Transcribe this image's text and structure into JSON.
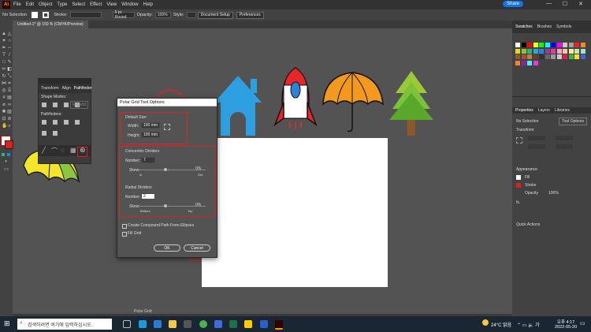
{
  "app": {
    "logo": "Ai"
  },
  "menu": {
    "items": [
      "File",
      "Edit",
      "Object",
      "Type",
      "Select",
      "Effect",
      "View",
      "Window",
      "Help"
    ],
    "share": "Share"
  },
  "control_bar": {
    "selection": "No Selection",
    "stroke_label": "Stroke:",
    "stroke_value": "5 pt. Round",
    "opacity_label": "Opacity:",
    "opacity_value": "100%",
    "style_label": "Style:",
    "doc_setup": "Document Setup",
    "preferences": "Preferences"
  },
  "document_tab": {
    "label": "Untitled-1* @ 150 % (CMYK/Preview)"
  },
  "pathfinder_panel": {
    "tabs": [
      "Transform",
      "Align",
      "Pathfinder"
    ],
    "shape_modes": "Shape Modes:",
    "expand": "Expand",
    "pathfinders": "Pathfinders:"
  },
  "dialog": {
    "title": "Polar Grid Tool Options",
    "default_size": "Default Size",
    "width_label": "Width:",
    "width_value": "100 mm",
    "height_label": "Height:",
    "height_value": "100 mm",
    "concentric": "Concentric Dividers",
    "conc_number_label": "Number:",
    "conc_number": "7",
    "conc_skew_label": "Skew:",
    "conc_skew": "0%",
    "conc_in": "In",
    "conc_out": "Out",
    "radial": "Radial Dividers",
    "rad_number_label": "Number:",
    "rad_number": "2",
    "rad_skew_label": "Skew:",
    "rad_skew": "0%",
    "rad_bottom": "Bottom",
    "rad_top": "Top",
    "compound": "Create Compound Path From Ellipses",
    "fill_grid": "Fill Grid",
    "ok": "OK",
    "cancel": "Cancel"
  },
  "right_panel": {
    "top_tabs": [
      "Swatches",
      "Brushes",
      "Symbols"
    ],
    "props_tabs": [
      "Properties",
      "Layers",
      "Libraries"
    ],
    "no_selection": "No Selection",
    "tool_options": "Tool Options",
    "transform": "Transform",
    "appearance": "Appearance",
    "fill": "Fill",
    "stroke": "Stroke",
    "opacity": "Opacity",
    "opacity_value": "100%",
    "fx": "fx.",
    "quick_actions": "Quick Actions"
  },
  "status": {
    "tool": "Polar Grid"
  },
  "taskbar": {
    "search_placeholder": "검색하려면 여기에 입력하십시오.",
    "weather": "24°C 맑음",
    "time": "오후 4:17",
    "date": "2022-05-20"
  },
  "colors": {
    "accent": "#1473e6",
    "highlight_red": "#e02020",
    "house": "#2e9fe0",
    "rocket_red": "#e8262a",
    "rocket_blue": "#2b84d6",
    "umbrella_orange": "#f39a1e",
    "tree_green": "#7cc23a",
    "tree_trunk": "#8b5a2b"
  },
  "swatch_colors": [
    "#ffffff",
    "#000000",
    "#ff0000",
    "#ffff00",
    "#00ff00",
    "#00ffff",
    "#0000ff",
    "#ff00ff",
    "#c8c8c8",
    "#a0a0a0",
    "#e8262a",
    "#f08c1e",
    "#f5d21e",
    "#8cc63f",
    "#2bb673",
    "#27a9e1",
    "#2b84d6",
    "#8e3fa0",
    "#ec3a8f",
    "#f6a6c8",
    "#f7c7a0",
    "#ffe8a0",
    "#c8e6a0",
    "#a0e0d8",
    "#8b5a2b",
    "#a0522d",
    "#c08040",
    "#6a3d1e",
    "#333333",
    "#666666",
    "#999999",
    "#cccccc",
    "#e6194b",
    "#3cb44b",
    "#ffe119",
    "#4363d8",
    "#f58231",
    "#911eb4",
    "#46f0f0",
    "#f032e6"
  ]
}
